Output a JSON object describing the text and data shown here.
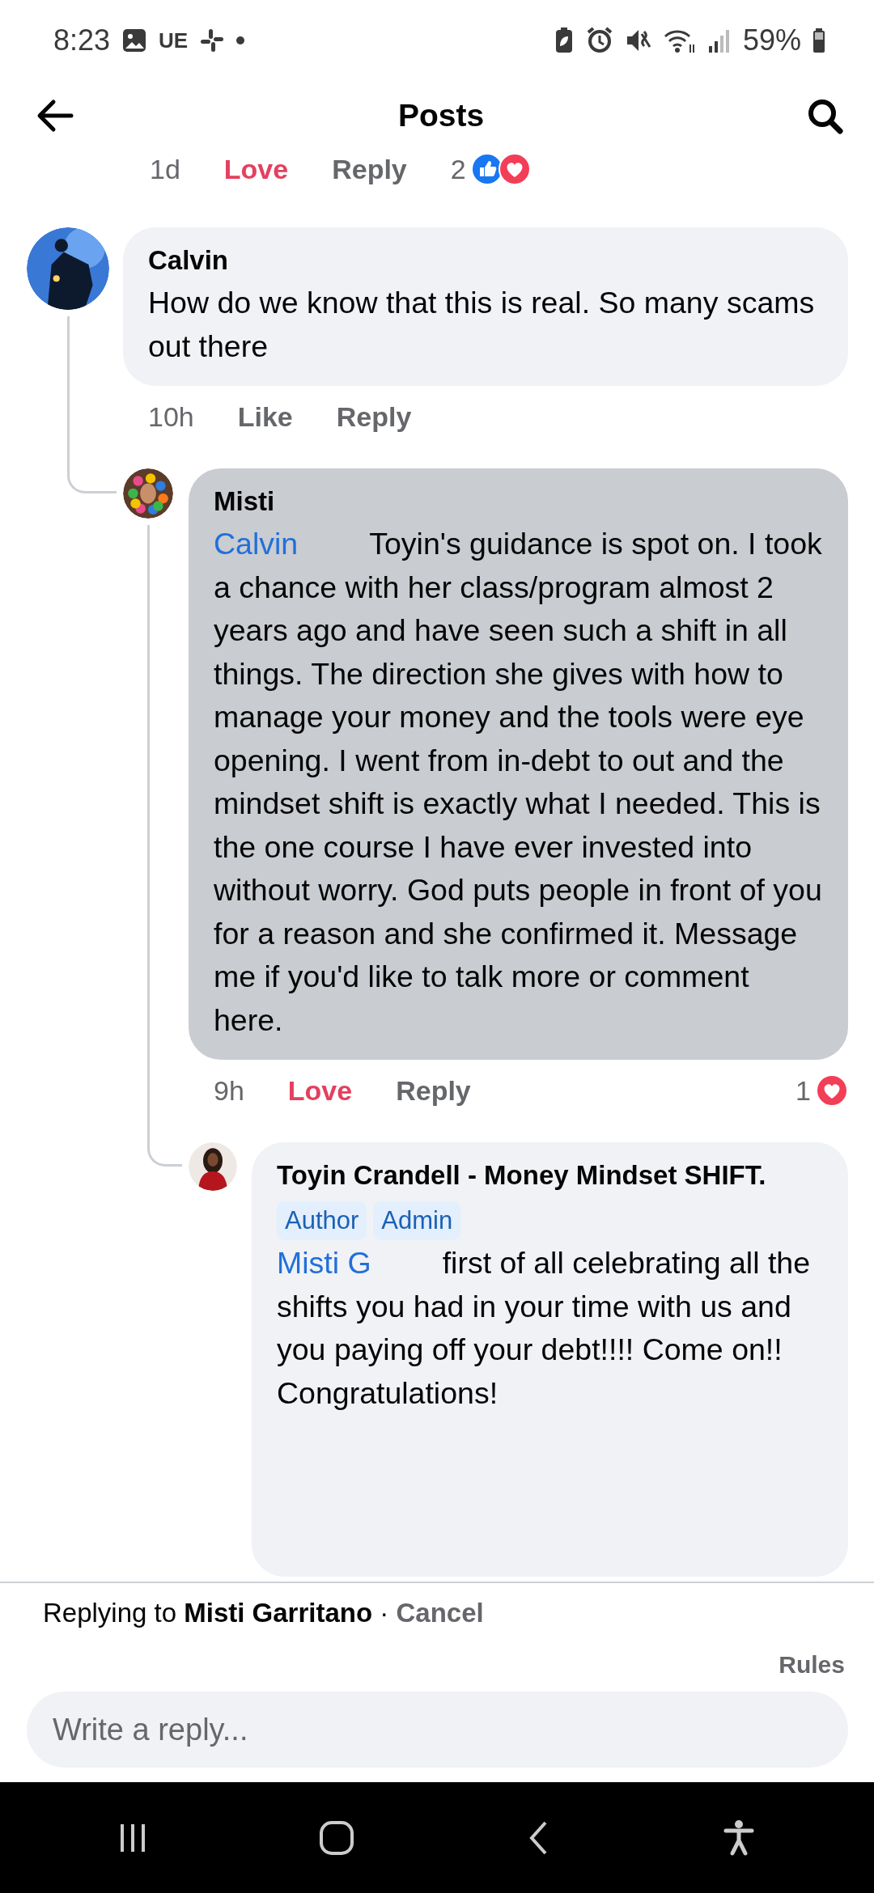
{
  "status_bar": {
    "time": "8:23",
    "app_badge": "UE",
    "battery": "59%"
  },
  "header": {
    "title": "Posts"
  },
  "previous_comment_actions": {
    "time": "1d",
    "reaction_label": "Love",
    "reacted": true,
    "reply_label": "Reply",
    "reaction_count": "2",
    "reactions": [
      {
        "kind": "like"
      },
      {
        "kind": "love"
      }
    ]
  },
  "comments": [
    {
      "author": "Calvin",
      "avatar": {
        "kind": "picture"
      },
      "highlighted": false,
      "text": "How do we know that this is real. So many scams out there",
      "actions": {
        "time": "10h",
        "reaction_label": "Like",
        "reacted": false,
        "reply_label": "Reply"
      },
      "children": [
        {
          "author": "Misti",
          "avatar": {
            "kind": "picture"
          },
          "highlighted": true,
          "mention": "Calvin",
          "text": "Toyin's guidance is spot on. I took a chance with her class/program almost 2 years ago and have seen such a shift in all things. The direction she gives with how to manage your money and the tools were eye opening. I went from in-debt to out and the mindset shift is exactly what I needed. This is the one course I have ever invested into without worry. God puts people in front of you for a reason and she confirmed it. Message me if you'd like to talk more or comment here.",
          "actions": {
            "time": "9h",
            "reaction_label": "Love",
            "reacted": true,
            "reply_label": "Reply",
            "reaction_count": "1",
            "reactions": [
              {
                "kind": "love"
              }
            ]
          },
          "children": [
            {
              "author": "Toyin Crandell - Money Mindset SHIFT.",
              "avatar": {
                "kind": "picture"
              },
              "highlighted": false,
              "badges": [
                "Author",
                "Admin"
              ],
              "mention": "Misti G",
              "text": "first of all celebrating all the shifts you had in your time with us and you paying off your debt!!!! Come on!! Congratulations!"
            }
          ]
        }
      ]
    }
  ],
  "reply_bar": {
    "prefix": "Replying to",
    "target": "Misti Garritano",
    "separator": "·",
    "cancel": "Cancel",
    "rules": "Rules",
    "placeholder": "Write a reply..."
  }
}
